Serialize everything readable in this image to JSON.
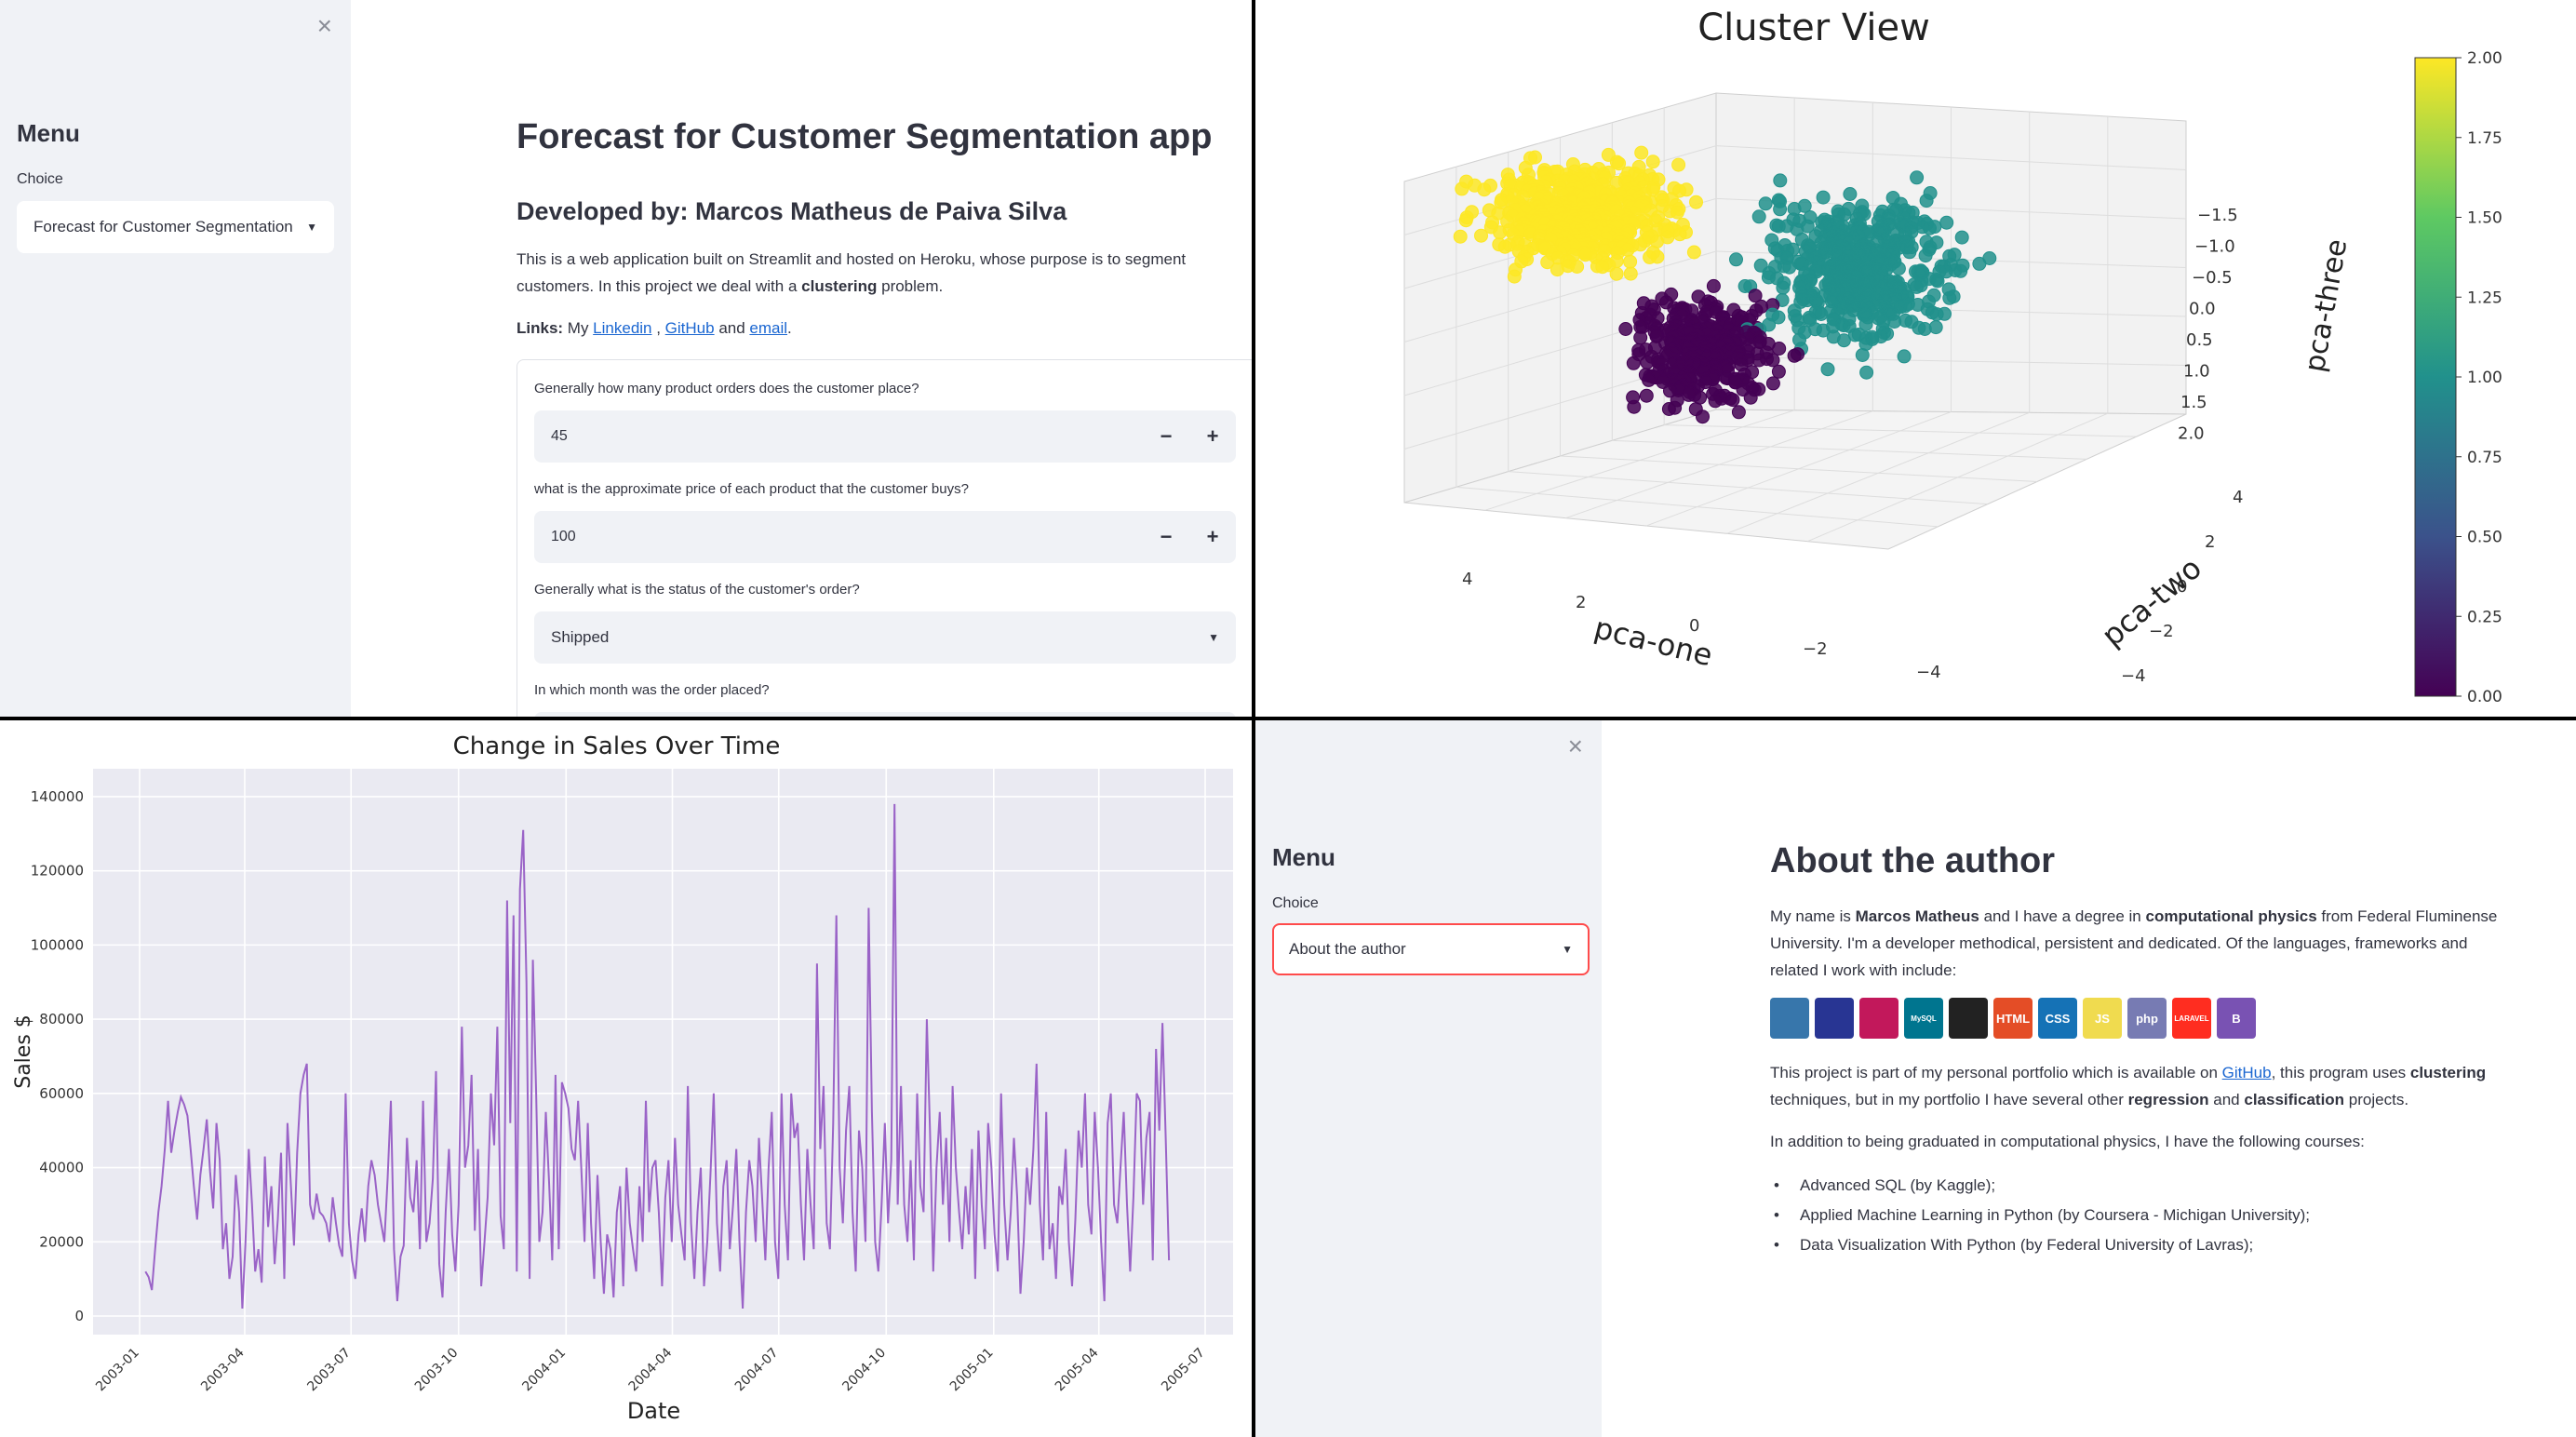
{
  "app1": {
    "close_glyph": "×",
    "menu_title": "Menu",
    "choice_label": "Choice",
    "choice_value": "Forecast for Customer Segmentation",
    "title": "Forecast for Customer Segmentation app",
    "subtitle": "Developed by: Marcos Matheus de Paiva Silva",
    "intro_line1": "This is a web application built on Streamlit and hosted on Heroku, whose purpose is to segment",
    "intro_line2_pre": "customers. In this project we deal with a ",
    "intro_line2_bold": "clustering",
    "intro_line2_post": " problem.",
    "links_label": "Links:",
    "links_my": " My ",
    "link_linkedin": "Linkedin",
    "links_sep1": " , ",
    "link_github": "GitHub",
    "links_and": " and ",
    "link_email": "email",
    "links_end": ".",
    "q1_label": "Generally how many product orders does the customer place?",
    "q1_value": "45",
    "q2_label": "what is the approximate price of each product that the customer buys?",
    "q2_value": "100",
    "q3_label": "Generally what is the status of the customer's order?",
    "q3_value": "Shipped",
    "q4_label": "In which month was the order placed?",
    "minus": "−",
    "plus": "+"
  },
  "app2": {
    "close_glyph": "×",
    "menu_title": "Menu",
    "choice_label": "Choice",
    "choice_value": "About the author",
    "title": "About the author",
    "p1_a": "My name is ",
    "p1_b": "Marcos Matheus",
    "p1_c": " and I have a degree in ",
    "p1_d": "computational physics",
    "p1_e": " from Federal Fluminense",
    "p1_line2": "University. I'm a developer methodical, persistent and dedicated. Of the languages, frameworks and",
    "p1_line3": "related I work with include:",
    "p2_a": "This project is part of my personal portfolio which is available on ",
    "p2_link": "GitHub",
    "p2_b": ", this program uses ",
    "p2_c": "clustering",
    "p2_line2_a": "techniques, but in my portfolio I have several other ",
    "p2_line2_b": "regression",
    "p2_line2_c": " and ",
    "p2_line2_d": "classification",
    "p2_line2_e": " projects.",
    "p3": "In addition to being graduated in computational physics, I have the following courses:",
    "courses": [
      "Advanced SQL (by Kaggle);",
      "Applied Machine Learning in Python (by Coursera - Michigan University);",
      "Data Visualization With Python (by Federal University of Lavras);"
    ],
    "tech_icons": [
      {
        "name": "python-icon",
        "color": "#3776ab"
      },
      {
        "name": "c-icon",
        "color": "#283593"
      },
      {
        "name": "cpp-icon",
        "color": "#c2185b"
      },
      {
        "name": "mysql-icon",
        "color": "#00758f",
        "label": "MySQL"
      },
      {
        "name": "linux-icon",
        "color": "#222222"
      },
      {
        "name": "html5-icon",
        "color": "#e44d26",
        "label": "HTML"
      },
      {
        "name": "css3-icon",
        "color": "#1572b6",
        "label": "CSS"
      },
      {
        "name": "javascript-icon",
        "color": "#f0db4f",
        "label": "JS"
      },
      {
        "name": "php-icon",
        "color": "#777bb3",
        "label": "php"
      },
      {
        "name": "laravel-icon",
        "color": "#ff2d20",
        "label": "LARAVEL"
      },
      {
        "name": "bootstrap-icon",
        "color": "#7952b3",
        "label": "B"
      }
    ]
  },
  "chart_data": [
    {
      "type": "scatter",
      "title": "Cluster View",
      "xlabel": "pca-one",
      "ylabel": "pca-two",
      "zlabel": "pca-three",
      "x_ticks": [
        "4",
        "2",
        "0",
        "−2",
        "−4"
      ],
      "y_ticks": [
        "4",
        "2",
        "0",
        "−2",
        "−4"
      ],
      "z_ticks": [
        "−1.5",
        "−1.0",
        "−0.5",
        "0.0",
        "0.5",
        "1.0",
        "1.5",
        "2.0"
      ],
      "colorbar_ticks": [
        "0.00",
        "0.25",
        "0.50",
        "0.75",
        "1.00",
        "1.25",
        "1.50",
        "1.75",
        "2.00"
      ],
      "colorbar_range": [
        0,
        2
      ],
      "colormap": "viridis",
      "series": [
        {
          "cluster": 0,
          "color": "#440154"
        },
        {
          "cluster": 1,
          "color": "#21918c"
        },
        {
          "cluster": 2,
          "color": "#fde725"
        }
      ]
    },
    {
      "type": "line",
      "title": "Change in Sales Over Time",
      "xlabel": "Date",
      "ylabel": "Sales $",
      "ylim": [
        0,
        145000
      ],
      "y_ticks": [
        0,
        20000,
        40000,
        60000,
        80000,
        100000,
        120000,
        140000
      ],
      "x_ticks": [
        "2003-01",
        "2003-04",
        "2003-07",
        "2003-10",
        "2004-01",
        "2004-04",
        "2004-07",
        "2004-10",
        "2005-01",
        "2005-04",
        "2005-07"
      ],
      "x_range": [
        "2003-01-01",
        "2005-07-01"
      ],
      "line_color": "#9a63c7",
      "x_start": "2003-01-06",
      "x_end": "2005-05-31",
      "values": [
        12000,
        10500,
        7000,
        18000,
        28000,
        35000,
        45000,
        58000,
        44000,
        50000,
        55000,
        59000,
        57000,
        54000,
        45000,
        35000,
        26000,
        38000,
        45000,
        53000,
        39000,
        29000,
        52000,
        42000,
        18000,
        25000,
        10000,
        16000,
        38000,
        28000,
        2000,
        20000,
        45000,
        30000,
        12000,
        18000,
        9000,
        43000,
        24000,
        35000,
        14000,
        26000,
        44000,
        10000,
        52000,
        36000,
        19000,
        44000,
        60000,
        65000,
        68000,
        30000,
        26000,
        33000,
        28000,
        27000,
        25000,
        20000,
        32000,
        25000,
        19000,
        16000,
        60000,
        25000,
        15000,
        10000,
        22000,
        29000,
        20000,
        35000,
        42000,
        38000,
        30000,
        25000,
        20000,
        37000,
        58000,
        18000,
        4000,
        16000,
        19000,
        48000,
        32000,
        28000,
        42000,
        18000,
        58000,
        20000,
        25000,
        37000,
        66000,
        14000,
        5000,
        28000,
        45000,
        22000,
        12000,
        30000,
        78000,
        40000,
        46000,
        65000,
        23000,
        45000,
        8000,
        20000,
        32000,
        60000,
        46000,
        78000,
        27000,
        18000,
        112000,
        52000,
        108000,
        12000,
        115000,
        131000,
        90000,
        10000,
        96000,
        60000,
        20000,
        28000,
        55000,
        36000,
        15000,
        65000,
        18000,
        63000,
        60000,
        56000,
        45000,
        42000,
        58000,
        40000,
        20000,
        52000,
        25000,
        10000,
        38000,
        20000,
        6000,
        22000,
        18000,
        5000,
        28000,
        35000,
        8000,
        40000,
        25000,
        18000,
        12000,
        35000,
        20000,
        58000,
        28000,
        40000,
        42000,
        28000,
        8000,
        32000,
        42000,
        20000,
        48000,
        30000,
        22000,
        15000,
        62000,
        25000,
        10000,
        28000,
        40000,
        8000,
        20000,
        38000,
        60000,
        25000,
        12000,
        35000,
        42000,
        18000,
        30000,
        45000,
        20000,
        2000,
        28000,
        42000,
        35000,
        20000,
        48000,
        32000,
        15000,
        40000,
        55000,
        20000,
        10000,
        60000,
        30000,
        15000,
        60000,
        48000,
        52000,
        30000,
        15000,
        45000,
        30000,
        18000,
        95000,
        45000,
        62000,
        25000,
        18000,
        52000,
        108000,
        40000,
        25000,
        50000,
        62000,
        28000,
        12000,
        50000,
        40000,
        20000,
        110000,
        55000,
        20000,
        12000,
        30000,
        52000,
        25000,
        42000,
        138000,
        30000,
        62000,
        30000,
        20000,
        42000,
        15000,
        60000,
        35000,
        28000,
        80000,
        50000,
        12000,
        40000,
        55000,
        30000,
        48000,
        20000,
        62000,
        40000,
        28000,
        18000,
        35000,
        22000,
        45000,
        10000,
        50000,
        30000,
        18000,
        52000,
        40000,
        22000,
        12000,
        60000,
        30000,
        15000,
        28000,
        48000,
        32000,
        6000,
        20000,
        40000,
        30000,
        45000,
        68000,
        30000,
        15000,
        55000,
        18000,
        25000,
        10000,
        35000,
        30000,
        45000,
        20000,
        8000,
        26000,
        50000,
        40000,
        60000,
        30000,
        22000,
        55000,
        40000,
        20000,
        4000,
        52000,
        60000,
        30000,
        25000,
        40000,
        55000,
        30000,
        12000,
        32000,
        60000,
        58000,
        30000,
        48000,
        55000,
        15000,
        72000,
        50000,
        79000,
        48000,
        15000
      ]
    }
  ]
}
